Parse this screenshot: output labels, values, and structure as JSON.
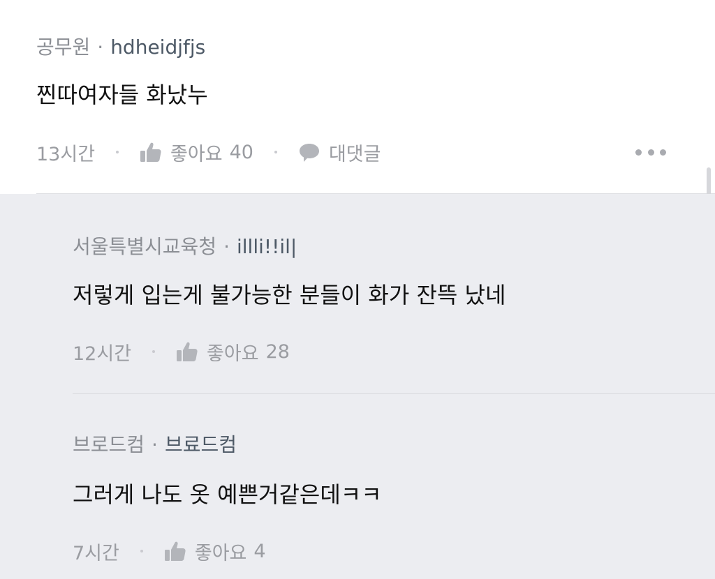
{
  "comment": {
    "affiliation": "공무원",
    "separator": "·",
    "user_id": "hdheidjfjs",
    "text": "찐따여자들 화났누",
    "time": "13시간",
    "like_label": "좋아요",
    "like_count": "40",
    "reply_label": "대댓글",
    "like_icon": "thumbs-up-icon",
    "reply_icon": "speech-bubble-icon",
    "more_icon": "more-dots-icon"
  },
  "replies": [
    {
      "affiliation": "서울특별시교육청",
      "separator": "·",
      "user_id": "illli!!il|",
      "text": "저렇게 입는게 불가능한 분들이 화가 잔뜩 났네",
      "time": "12시간",
      "like_label": "좋아요",
      "like_count": "28"
    },
    {
      "affiliation": "브로드컴",
      "separator": "·",
      "user_id": "브료드컴",
      "text": "그러게 나도 옷 예쁜거같은데ㅋㅋ",
      "time": "7시간",
      "like_label": "좋아요",
      "like_count": "4"
    }
  ],
  "colors": {
    "background_main": "#ffffff",
    "background_replies": "#ecedf1",
    "meta_text": "#9a9ca1",
    "body_text": "#111111",
    "user_id_text": "#4d5966"
  }
}
